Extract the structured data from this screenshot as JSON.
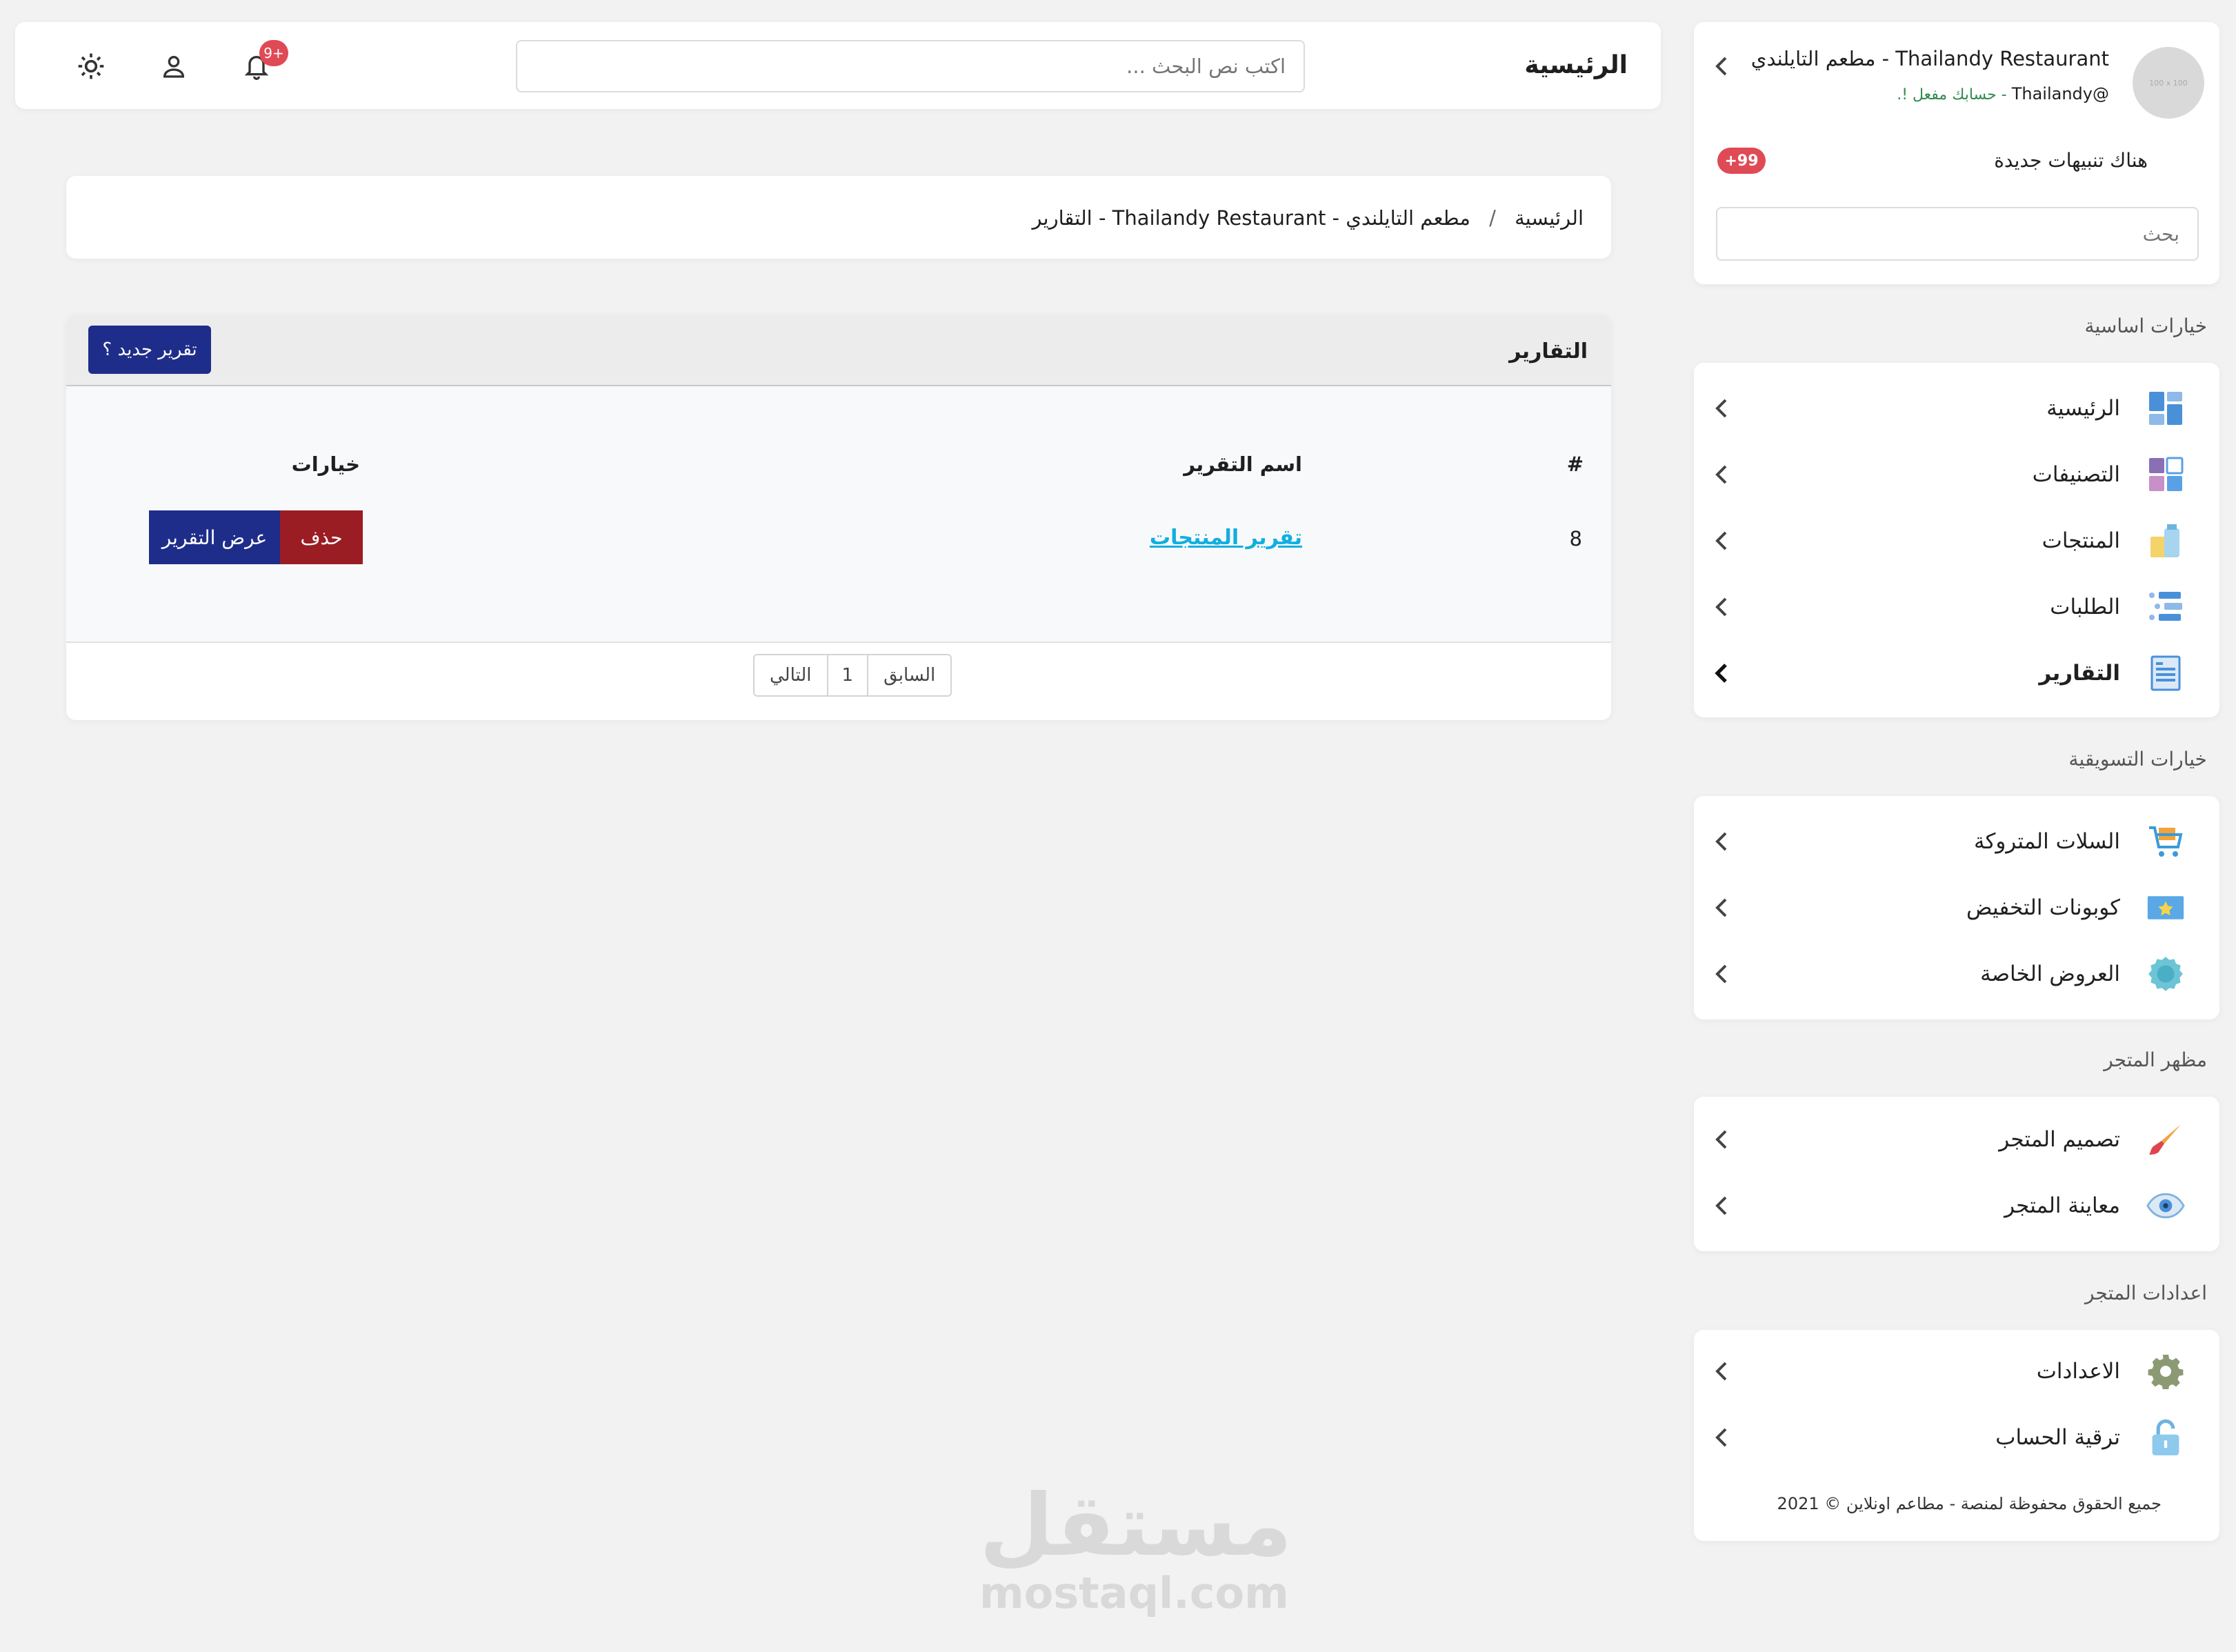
{
  "topbar": {
    "title": "الرئيسية",
    "search_placeholder": "اكتب نص البحث ...",
    "notification_badge": "9+"
  },
  "profile": {
    "avatar_text": "100 x 100",
    "name": "مطعم التايلندي - Thailandy Restaurant",
    "handle": "@Thailandy",
    "status": " - حسابك مفعل !.",
    "alerts_text": "هناك تنبيهات جديدة",
    "alerts_badge": "+99",
    "search_placeholder": "بحث"
  },
  "sidebar": {
    "sections": [
      {
        "title": "خيارات اساسية",
        "items": [
          {
            "label": "الرئيسية",
            "icon": "dashboard-icon"
          },
          {
            "label": "التصنيفات",
            "icon": "categories-icon"
          },
          {
            "label": "المنتجات",
            "icon": "products-icon"
          },
          {
            "label": "الطلبات",
            "icon": "orders-icon"
          },
          {
            "label": "التقارير",
            "icon": "reports-icon",
            "active": true
          }
        ]
      },
      {
        "title": "خيارات التسويقية",
        "items": [
          {
            "label": "السلات المتروكة",
            "icon": "cart-icon"
          },
          {
            "label": "كوبونات التخفيض",
            "icon": "coupon-icon"
          },
          {
            "label": "العروض الخاصة",
            "icon": "offer-badge-icon"
          }
        ]
      },
      {
        "title": "مظهر المتجر",
        "items": [
          {
            "label": "تصميم المتجر",
            "icon": "brush-icon"
          },
          {
            "label": "معاينة المتجر",
            "icon": "eye-icon"
          }
        ]
      },
      {
        "title": "اعدادات المتجر",
        "items": [
          {
            "label": "الاعدادات",
            "icon": "gear-icon"
          },
          {
            "label": "ترقية الحساب",
            "icon": "lock-icon"
          }
        ]
      }
    ],
    "footer": "جميع الحقوق محفوظة لمنصة - مطاعم اونلاين © 2021"
  },
  "breadcrumb": {
    "home": "الرئيسية",
    "separator": "/",
    "current": "مطعم التايلندي - Thailandy Restaurant - التقارير"
  },
  "reports": {
    "title": "التقارير",
    "new_button": "تقرير جديد ؟",
    "columns": {
      "number": "#",
      "name": "اسم التقرير",
      "options": "خيارات"
    },
    "rows": [
      {
        "number": "8",
        "name": "تقرير المنتجات",
        "delete": "حذف",
        "view": "عرض التقرير"
      }
    ],
    "pagination": {
      "prev": "السابق",
      "page": "1",
      "next": "التالي"
    }
  },
  "watermark": {
    "arabic": "مستقل",
    "latin": "mostaql.com"
  },
  "colors": {
    "primary": "#1f2d8a",
    "danger": "#9b1d24",
    "link": "#11aee0",
    "badge": "#e04a55"
  }
}
